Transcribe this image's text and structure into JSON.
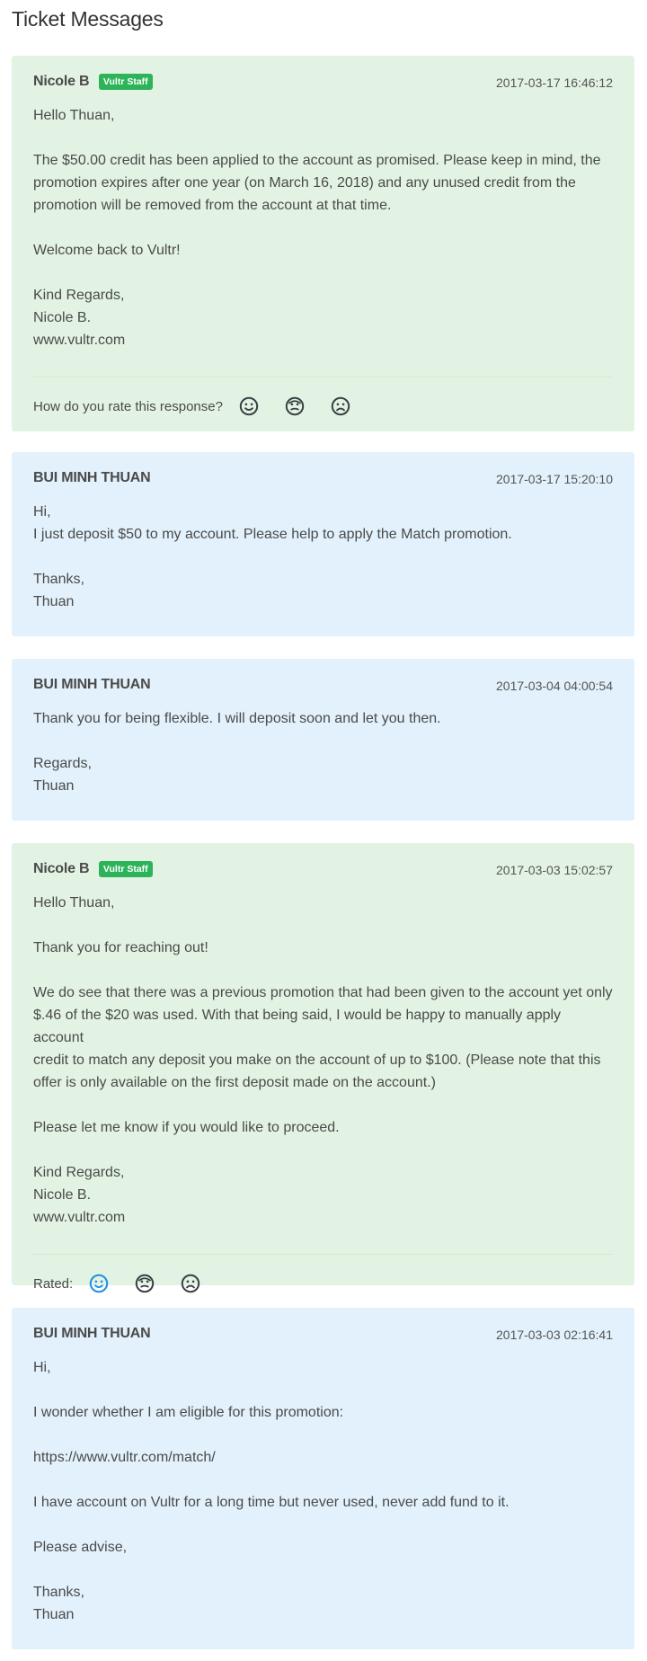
{
  "page": {
    "title": "Ticket Messages"
  },
  "colors": {
    "staff_bg": "#e3f3e3",
    "user_bg": "#e2f1fb",
    "badge": "#2db35a",
    "rated_active": "#1f8fe6",
    "face_default": "#3a3f44"
  },
  "messages": [
    {
      "author": "Nicole B",
      "badge": "Vultr Staff",
      "date": "2017-03-17 16:46:12",
      "lines": [
        "Hello Thuan,",
        "",
        "The $50.00 credit has been applied to the account as promised. Please keep in mind, the",
        "promotion expires after one year (on March 16, 2018) and any unused credit from the",
        "promotion will be removed from the account at that time.",
        "",
        "Welcome back to Vultr!",
        "",
        "Kind Regards,",
        "Nicole B.",
        "www.vultr.com"
      ],
      "rating_label": "How do you rate this response?",
      "rating_icons": [
        "smile-icon",
        "neutral-icon",
        "frown-icon"
      ]
    },
    {
      "author": "BUI MINH THUAN",
      "date": "2017-03-17 15:20:10",
      "lines": [
        "Hi,",
        "I just deposit $50 to my account. Please help to apply the Match promotion.",
        "",
        "Thanks,",
        "Thuan"
      ]
    },
    {
      "author": "BUI MINH THUAN",
      "date": "2017-03-04 04:00:54",
      "lines": [
        "Thank you for being flexible. I will deposit soon and let you then.",
        "",
        "Regards,",
        "Thuan"
      ]
    },
    {
      "author": "Nicole B",
      "badge": "Vultr Staff",
      "date": "2017-03-03 15:02:57",
      "lines": [
        "Hello Thuan,",
        "",
        "Thank you for reaching out!",
        "",
        "We do see that there was a previous promotion that had been given to the account yet only",
        "$.46 of the $20 was used. With that being said, I would be happy to manually apply account",
        "credit to match any deposit you make on the account of up to $100. (Please note that this",
        "offer is only available on the first deposit made on the account.)",
        "",
        "Please let me know if you would like to proceed.",
        "",
        "Kind Regards,",
        "Nicole B.",
        "www.vultr.com"
      ],
      "rating_label": "Rated:",
      "rating_icons": [
        "smile-icon",
        "neutral-icon",
        "frown-icon"
      ],
      "rated_selected": "smile-icon"
    },
    {
      "author": "BUI MINH THUAN",
      "date": "2017-03-03 02:16:41",
      "lines": [
        "Hi,",
        "",
        "I wonder whether I am eligible for this promotion:",
        "",
        "https://www.vultr.com/match/",
        "",
        "I have account on Vultr for a long time but never used, never add fund to it.",
        "",
        "Please advise,",
        "",
        "Thanks,",
        "Thuan"
      ]
    }
  ]
}
